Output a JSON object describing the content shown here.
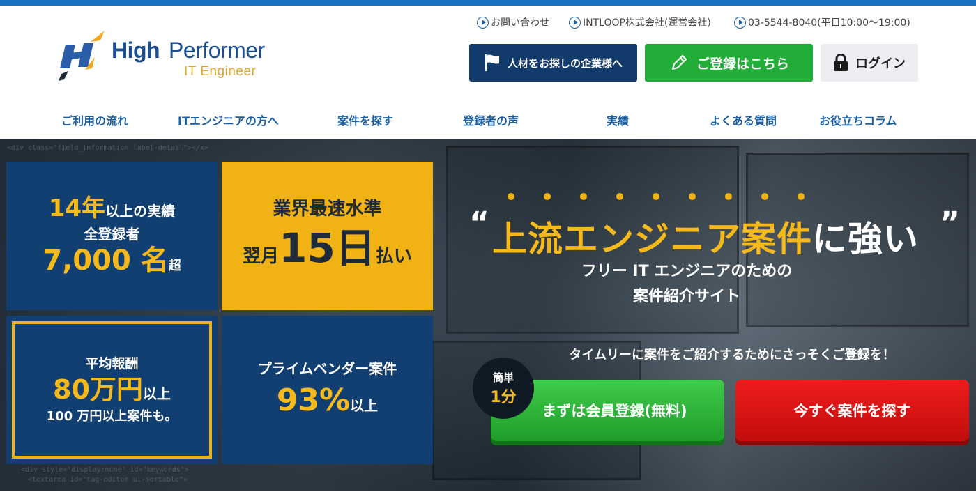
{
  "brand": {
    "name_high": "High",
    "name_performer": "Performer",
    "tagline": "IT Engineer",
    "accent": "#1b4f8f",
    "accent_secondary": "#e2a52a"
  },
  "utility_links": [
    {
      "label": "お問い合わせ",
      "icon": "play-circle-icon"
    },
    {
      "label": "INTLOOP株式会社(運営会社)",
      "icon": "play-circle-icon"
    },
    {
      "label": "03-5544-8040(平日10:00〜19:00)",
      "icon": "play-circle-icon"
    }
  ],
  "header_buttons": {
    "corporate": {
      "label": "人材をお探しの企業様へ",
      "icon": "flag-icon",
      "color": "#123a6b"
    },
    "register": {
      "label": "ご登録はこちら",
      "icon": "pencil-icon",
      "color": "#21ad37"
    },
    "login": {
      "label": "ログイン",
      "icon": "lock-icon",
      "color": "#eceef1"
    }
  },
  "nav": [
    "ご利用の流れ",
    "ITエンジニアの方へ",
    "案件を探す",
    "登録者の声",
    "実績",
    "よくある質問",
    "お役立ちコラム"
  ],
  "tiles": {
    "t1": {
      "years": "14年",
      "years_suffix": "以上の実績",
      "label": "全登録者",
      "count": "7,000 名",
      "count_suffix": "超"
    },
    "t2": {
      "label": "業界最速水準",
      "prefix": "翌月",
      "days": "15日",
      "suffix": "払い"
    },
    "t3": {
      "label": "平均報酬",
      "amount": "80万円",
      "amount_suffix": "以上",
      "note": "100 万円以上案件も。"
    },
    "t4": {
      "label": "プライムベンダー案件",
      "percent": "93%",
      "percent_suffix": "以上"
    }
  },
  "hero": {
    "quote_open": "“",
    "quote_close": "”",
    "headline_highlight": "上流エンジニア案件",
    "headline_rest": "に強い",
    "sub_line1": "フリー IT エンジニアのための",
    "sub_line2": "案件紹介サイト",
    "timely": "タイムリーに案件をご紹介するためにさっそくご登録を！",
    "badge_line1": "簡単",
    "badge_line2": "1分",
    "cta_register": "まずは会員登録(無料)",
    "cta_search": "今すぐ案件を探す",
    "colors": {
      "yellow": "#f5b91c",
      "green": "#21ad37",
      "red": "#e01515",
      "navy": "#123f72"
    }
  }
}
